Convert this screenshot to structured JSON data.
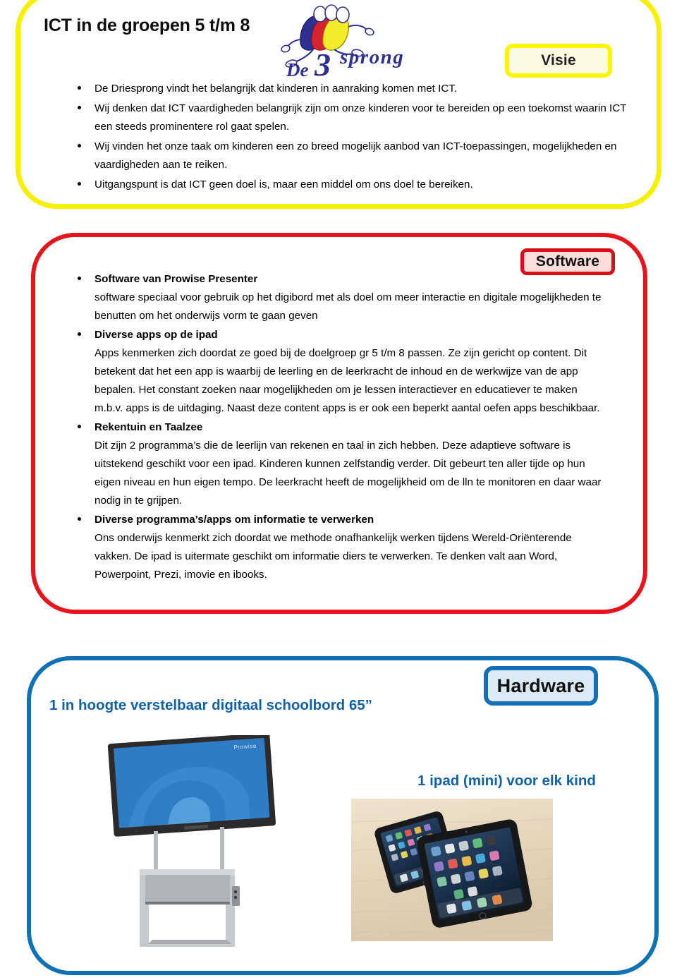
{
  "document": {
    "title": "ICT in de groepen 5 t/m 8"
  },
  "logo": {
    "name": "de-3sprong-logo",
    "word_de": "De",
    "numeral": "3",
    "word_sprong": "sprong",
    "figure_colors": [
      "#2e3192",
      "#d6232f",
      "#f4ec2a"
    ]
  },
  "sections": {
    "visie": {
      "badge": "Visie",
      "border_color": "#f7f000",
      "badge_fill": "#fbfbe2",
      "bullets": [
        "De Driesprong vindt het belangrijk dat kinderen in aanraking komen met ICT.",
        "Wij denken dat ICT vaardigheden belangrijk zijn om onze kinderen voor te bereiden op een toekomst waarin ICT een steeds prominentere  rol gaat spelen.",
        "Wij vinden het onze taak om kinderen een zo breed mogelijk aanbod van ICT-toepassingen, mogelijkheden en vaardigheden aan te reiken.",
        "Uitgangspunt is dat ICT geen doel is, maar een middel om ons doel te bereiken."
      ]
    },
    "software": {
      "badge": "Software",
      "border_color": "#e8141c",
      "badge_fill": "#fbdddc",
      "items": [
        {
          "heading": "Software van Prowise Presenter",
          "body": "software speciaal voor gebruik op het digibord met als doel om meer interactie en digitale mogelijkheden te benutten om het onderwijs vorm te gaan geven"
        },
        {
          "heading": "Diverse apps op de ipad",
          "body": "Apps kenmerken zich doordat ze goed bij de doelgroep gr  5 t/m 8 passen. Ze zijn gericht op content. Dit betekent dat het een app is waarbij de leerling en de leerkracht de inhoud en de werkwijze van de app bepalen. Het constant zoeken naar mogelijkheden om je lessen interactiever en educatiever  te maken m.b.v. apps is de uitdaging. Naast deze content apps is er ook een beperkt aantal oefen apps beschikbaar."
        },
        {
          "heading": "Rekentuin en Taalzee",
          "body": "Dit zijn 2 programma’s die de leerlijn van rekenen en taal in zich hebben. Deze adaptieve software is uitstekend geschikt voor een ipad. Kinderen kunnen zelfstandig verder. Dit gebeurt ten aller tijde op hun eigen niveau en hun eigen tempo. De leerkracht heeft de mogelijkheid om de lln te monitoren en daar waar nodig in te grijpen."
        },
        {
          "heading": "Diverse programma’s/apps  om informatie te verwerken",
          "body": "Ons onderwijs kenmerkt zich doordat we methode onafhankelijk werken tijdens Wereld-Oriënterende vakken. De ipad is uitermate geschikt om informatie diers te verwerken. Te denken valt aan Word, Powerpoint, Prezi, imovie en ibooks."
        }
      ]
    },
    "hardware": {
      "badge": "Hardware",
      "border_color": "#0f72b5",
      "badge_fill": "#dbeaf7",
      "heading_color": "#1161a8",
      "board_heading": "1 in hoogte verstelbaar digitaal schoolbord 65”",
      "board_image_name": "digital-schoolboard-on-height-adjustable-stand",
      "ipad_heading": "1 ipad (mini) voor elk kind",
      "ipad_image_name": "two-ipads-on-wooden-desk-photo"
    }
  }
}
